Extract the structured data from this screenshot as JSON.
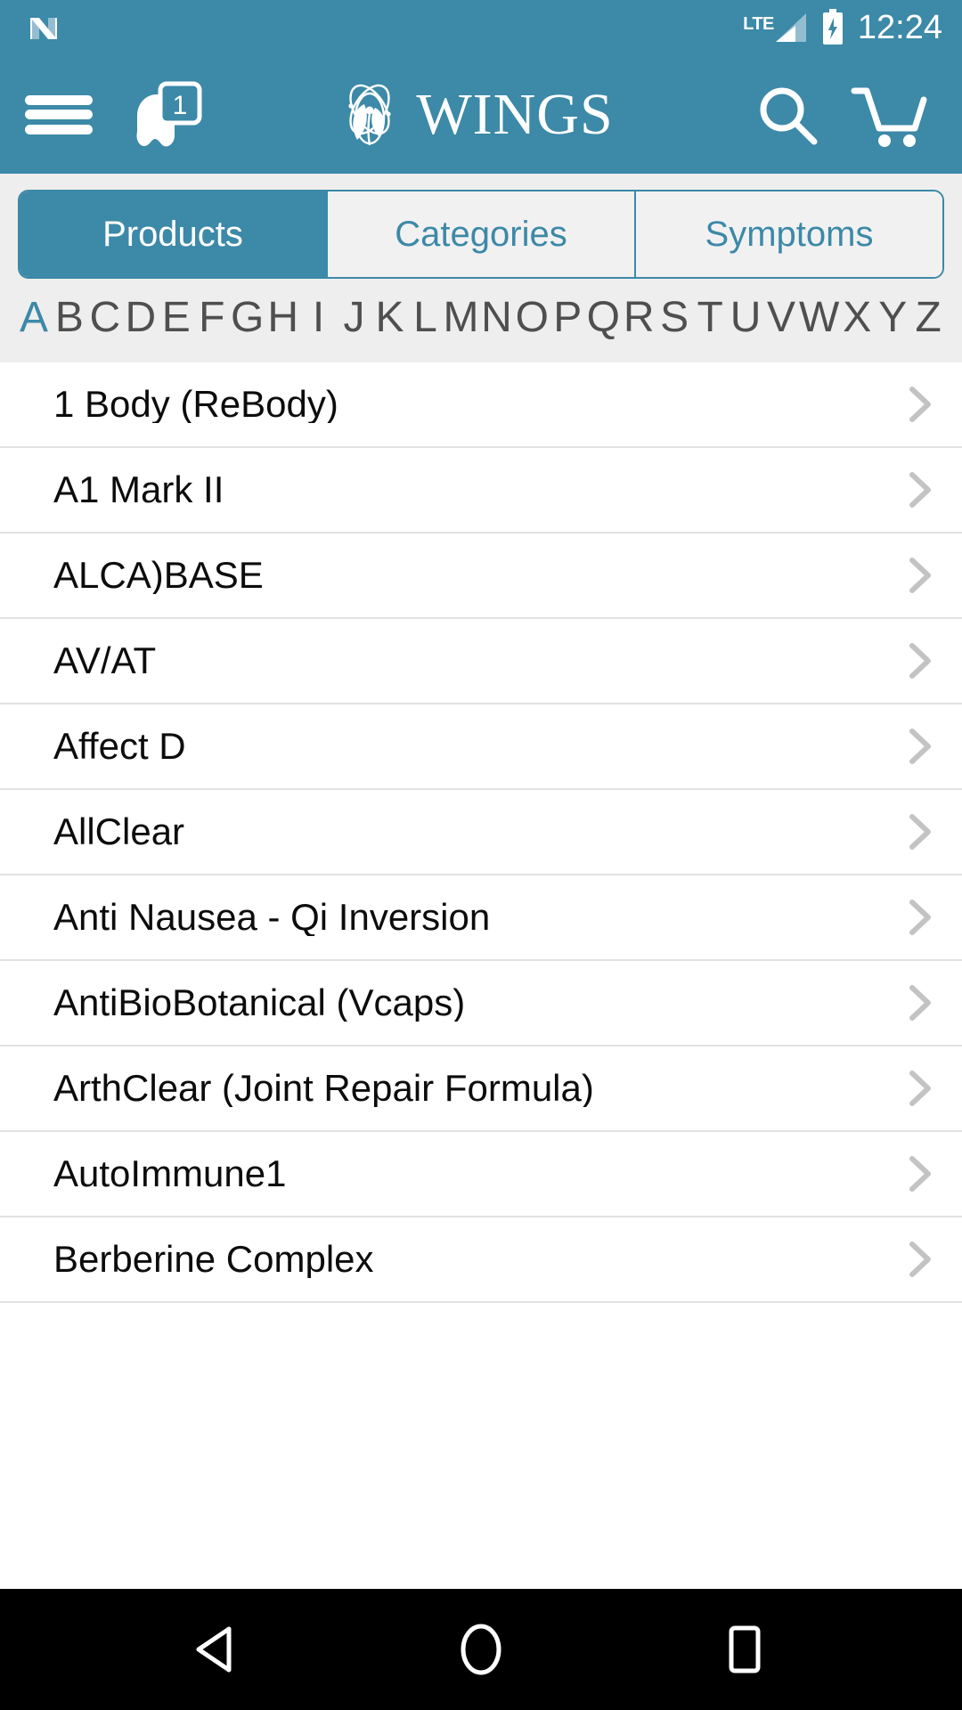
{
  "status_bar": {
    "nougat_icon": "android-nougat-icon",
    "network_label": "LTE",
    "signal_icon": "signal-bars-icon",
    "battery_icon": "battery-charging-icon",
    "time": "12:24"
  },
  "header": {
    "menu_icon": "hamburger-menu-icon",
    "notification_icon": "notification-icon",
    "notification_badge": "1",
    "logo_icon": "wings-flower-logo-icon",
    "brand": "WINGS",
    "search_icon": "search-icon",
    "cart_icon": "shopping-cart-icon"
  },
  "tabs": {
    "items": [
      {
        "label": "Products",
        "active": true
      },
      {
        "label": "Categories",
        "active": false
      },
      {
        "label": "Symptoms",
        "active": false
      }
    ]
  },
  "alphabet": {
    "selected": "A",
    "letters": [
      "A",
      "B",
      "C",
      "D",
      "E",
      "F",
      "G",
      "H",
      "I",
      "J",
      "K",
      "L",
      "M",
      "N",
      "O",
      "P",
      "Q",
      "R",
      "S",
      "T",
      "U",
      "V",
      "W",
      "X",
      "Y",
      "Z"
    ]
  },
  "products": {
    "items": [
      {
        "name": "1 Body (ReBody)"
      },
      {
        "name": "A1 Mark II"
      },
      {
        "name": "ALCA)BASE"
      },
      {
        "name": "AV/AT"
      },
      {
        "name": "Affect D"
      },
      {
        "name": "AllClear"
      },
      {
        "name": "Anti Nausea - Qi Inversion"
      },
      {
        "name": "AntiBioBotanical (Vcaps)"
      },
      {
        "name": "ArthClear (Joint Repair Formula)"
      },
      {
        "name": "AutoImmune1"
      },
      {
        "name": "Berberine Complex"
      }
    ],
    "chevron_icon": "chevron-right-icon"
  },
  "nav_bar": {
    "back_icon": "back-triangle-icon",
    "home_icon": "home-circle-icon",
    "recents_icon": "recents-square-icon"
  },
  "colors": {
    "brand_teal": "#3c89a8",
    "page_bg": "#efeeee",
    "list_bg": "#ffffff",
    "divider": "#e2e2e2",
    "text_primary": "#0c0c0c",
    "alpha_text": "#4f4f4f"
  }
}
